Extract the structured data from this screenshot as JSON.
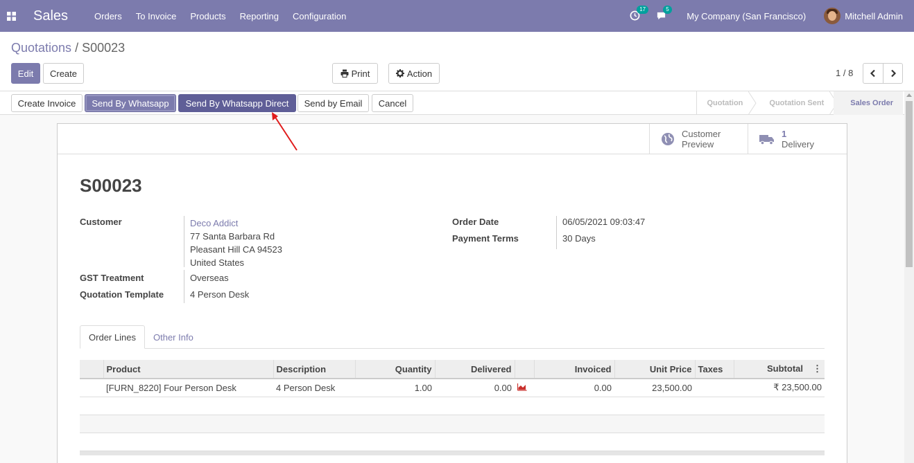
{
  "navbar": {
    "app_name": "Sales",
    "menu": [
      "Orders",
      "To Invoice",
      "Products",
      "Reporting",
      "Configuration"
    ],
    "activity_count": "17",
    "messages_count": "5",
    "company": "My Company (San Francisco)",
    "user": "Mitchell Admin",
    "color": "#7c7bad"
  },
  "breadcrumb": {
    "parent": "Quotations",
    "separator": "/",
    "current": "S00023"
  },
  "buttons": {
    "edit": "Edit",
    "create": "Create",
    "print": "Print",
    "action": "Action"
  },
  "pager": {
    "value": "1 / 8"
  },
  "statusbar": {
    "buttons": [
      "Create Invoice",
      "Send By Whatsapp",
      "Send By Whatsapp Direct",
      "Send by Email",
      "Cancel"
    ],
    "stages": [
      "Quotation",
      "Quotation Sent",
      "Sales Order"
    ],
    "active_stage": "Sales Order"
  },
  "smart_buttons": {
    "customer_preview_line1": "Customer",
    "customer_preview_line2": "Preview",
    "delivery_count": "1",
    "delivery_label": "Delivery"
  },
  "order": {
    "name": "S00023",
    "customer_label": "Customer",
    "customer_name": "Deco Addict",
    "address_line1": "77 Santa Barbara Rd",
    "address_line2": "Pleasant Hill CA 94523",
    "address_line3": "United States",
    "gst_label": "GST Treatment",
    "gst_value": "Overseas",
    "template_label": "Quotation Template",
    "template_value": "4 Person Desk",
    "order_date_label": "Order Date",
    "order_date_value": "06/05/2021 09:03:47",
    "payment_terms_label": "Payment Terms",
    "payment_terms_value": "30 Days"
  },
  "tabs": [
    "Order Lines",
    "Other Info"
  ],
  "order_lines": {
    "headers": {
      "product": "Product",
      "description": "Description",
      "quantity": "Quantity",
      "delivered": "Delivered",
      "invoiced": "Invoiced",
      "unit_price": "Unit Price",
      "taxes": "Taxes",
      "subtotal": "Subtotal"
    },
    "rows": [
      {
        "product": "[FURN_8220] Four Person Desk",
        "description": "4 Person Desk",
        "quantity": "1.00",
        "delivered": "0.00",
        "invoiced": "0.00",
        "unit_price": "23,500.00",
        "taxes": "",
        "subtotal": "₹ 23,500.00"
      }
    ]
  },
  "annotation_arrow_color": "#e01b1b"
}
